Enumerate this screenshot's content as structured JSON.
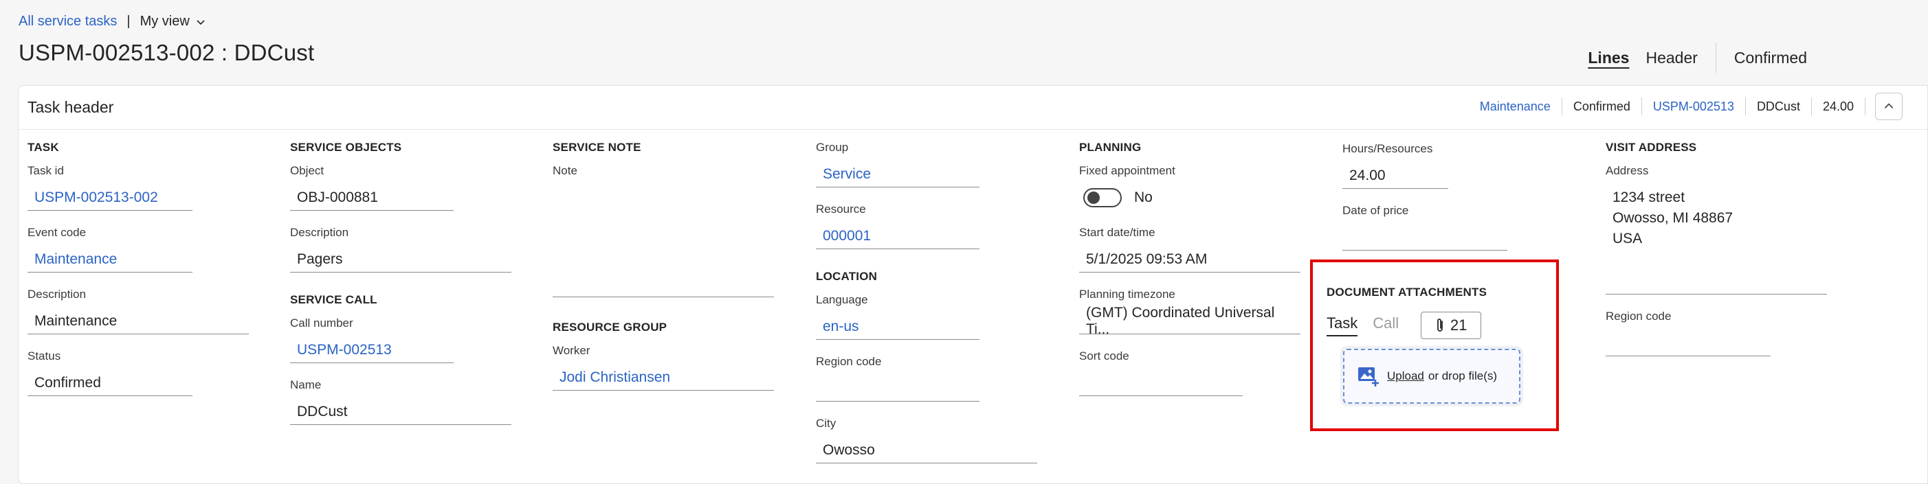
{
  "breadcrumb": {
    "link": "All service tasks",
    "sep": "|",
    "view": "My view"
  },
  "page_title": "USPM-002513-002 : DDCust",
  "view_tabs": [
    "Lines",
    "Header",
    "Confirmed"
  ],
  "card": {
    "title": "Task header",
    "summary": [
      "Maintenance",
      "Confirmed",
      "USPM-002513",
      "DDCust",
      "24.00"
    ]
  },
  "task": {
    "section": "TASK",
    "task_id_label": "Task id",
    "task_id": "USPM-002513-002",
    "event_code_label": "Event code",
    "event_code": "Maintenance",
    "description_label": "Description",
    "description": "Maintenance",
    "status_label": "Status",
    "status": "Confirmed"
  },
  "service_objects": {
    "section": "SERVICE OBJECTS",
    "object_label": "Object",
    "object": "OBJ-000881",
    "description_label": "Description",
    "description": "Pagers"
  },
  "service_call": {
    "section": "SERVICE CALL",
    "call_number_label": "Call number",
    "call_number": "USPM-002513",
    "name_label": "Name",
    "name": "DDCust"
  },
  "service_note": {
    "section": "SERVICE NOTE",
    "note_label": "Note",
    "note": ""
  },
  "resource_group": {
    "section": "RESOURCE GROUP",
    "worker_label": "Worker",
    "worker": "Jodi Christiansen"
  },
  "group": {
    "group_label": "Group",
    "group": "Service",
    "resource_label": "Resource",
    "resource": "000001"
  },
  "location": {
    "section": "LOCATION",
    "language_label": "Language",
    "language": "en-us",
    "region_code_label": "Region code",
    "region_code": "",
    "city_label": "City",
    "city": "Owosso"
  },
  "planning": {
    "section": "PLANNING",
    "fixed_appointment_label": "Fixed appointment",
    "fixed_appointment": "No",
    "start_label": "Start date/time",
    "start": "5/1/2025 09:53 AM",
    "timezone_label": "Planning timezone",
    "timezone": "(GMT) Coordinated Universal Ti...",
    "sort_code_label": "Sort code",
    "sort_code": ""
  },
  "hours": {
    "hours_label": "Hours/Resources",
    "hours": "24.00",
    "date_of_price_label": "Date of price",
    "date_of_price": ""
  },
  "attachments": {
    "section": "DOCUMENT ATTACHMENTS",
    "tab_task": "Task",
    "tab_call": "Call",
    "count": "21",
    "upload_link": "Upload",
    "upload_rest": "or drop file(s)"
  },
  "visit_address": {
    "section": "VISIT ADDRESS",
    "address_label": "Address",
    "address_line1": "1234 street",
    "address_line2": "Owosso, MI 48867",
    "address_line3": "USA",
    "region_code_label": "Region code",
    "region_code": ""
  },
  "colors": {
    "link": "#2b63c5",
    "highlight": "#e00000"
  }
}
